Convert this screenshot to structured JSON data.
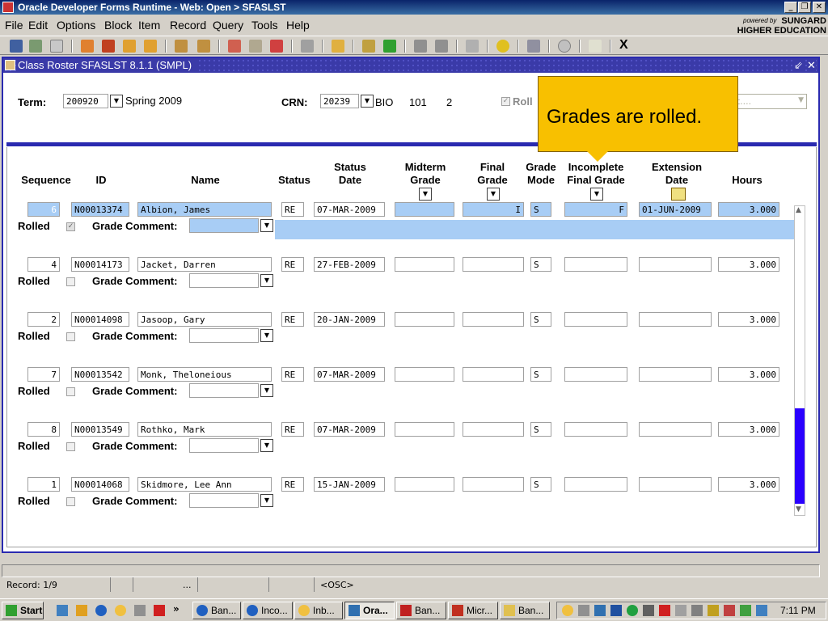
{
  "window": {
    "title": "Oracle Developer Forms Runtime - Web:  Open > SFASLST"
  },
  "brand": {
    "powered_by": "powered by",
    "line1": "SUNGARD",
    "line2": "HIGHER EDUCATION"
  },
  "menu": [
    {
      "label": "File",
      "accel": "F"
    },
    {
      "label": "Edit",
      "accel": "E"
    },
    {
      "label": "Options",
      "accel": "O"
    },
    {
      "label": "Block",
      "accel": "B"
    },
    {
      "label": "Item",
      "accel": "I"
    },
    {
      "label": "Record",
      "accel": "R"
    },
    {
      "label": "Query",
      "accel": "Q"
    },
    {
      "label": "Tools",
      "accel": "T"
    },
    {
      "label": "Help",
      "accel": "H"
    }
  ],
  "toolbar": {
    "exit_label": "X"
  },
  "form": {
    "title": "Class Roster  SFASLST  8.1.1  (SMPL)",
    "term_label": "Term:",
    "term_value": "200920",
    "term_desc": "Spring 2009",
    "crn_label": "CRN:",
    "crn_value": "20239",
    "subject": "BIO",
    "course": "101",
    "section": "2",
    "roll_label": "Roll",
    "select_placeholder": "ect...."
  },
  "columns": {
    "sequence": "Sequence",
    "id": "ID",
    "name": "Name",
    "status": "Status",
    "status_date": [
      "Status",
      "Date"
    ],
    "midterm": [
      "Midterm",
      "Grade"
    ],
    "final": [
      "Final",
      "Grade"
    ],
    "grade_mode": [
      "Grade",
      "Mode"
    ],
    "incomplete": [
      "Incomplete",
      "Final Grade"
    ],
    "extension": [
      "Extension",
      "Date"
    ],
    "hours": "Hours"
  },
  "row_labels": {
    "rolled": "Rolled",
    "grade_comment": "Grade Comment:"
  },
  "rows": [
    {
      "seq": "6",
      "id": "N00013374",
      "name": "Albion, James",
      "status": "RE",
      "date": "07-MAR-2009",
      "midterm": "",
      "final": "I",
      "mode": "S",
      "incomplete": "F",
      "extension": "01-JUN-2009",
      "hours": "3.000",
      "rolled": true,
      "selected": true
    },
    {
      "seq": "4",
      "id": "N00014173",
      "name": "Jacket, Darren",
      "status": "RE",
      "date": "27-FEB-2009",
      "midterm": "",
      "final": "",
      "mode": "S",
      "incomplete": "",
      "extension": "",
      "hours": "3.000",
      "rolled": false,
      "selected": false
    },
    {
      "seq": "2",
      "id": "N00014098",
      "name": "Jasoop, Gary",
      "status": "RE",
      "date": "20-JAN-2009",
      "midterm": "",
      "final": "",
      "mode": "S",
      "incomplete": "",
      "extension": "",
      "hours": "3.000",
      "rolled": false,
      "selected": false
    },
    {
      "seq": "7",
      "id": "N00013542",
      "name": "Monk, Theloneious",
      "status": "RE",
      "date": "07-MAR-2009",
      "midterm": "",
      "final": "",
      "mode": "S",
      "incomplete": "",
      "extension": "",
      "hours": "3.000",
      "rolled": false,
      "selected": false
    },
    {
      "seq": "8",
      "id": "N00013549",
      "name": "Rothko, Mark",
      "status": "RE",
      "date": "07-MAR-2009",
      "midterm": "",
      "final": "",
      "mode": "S",
      "incomplete": "",
      "extension": "",
      "hours": "3.000",
      "rolled": false,
      "selected": false
    },
    {
      "seq": "1",
      "id": "N00014068",
      "name": "Skidmore, Lee Ann",
      "status": "RE",
      "date": "15-JAN-2009",
      "midterm": "",
      "final": "",
      "mode": "S",
      "incomplete": "",
      "extension": "",
      "hours": "3.000",
      "rolled": false,
      "selected": false
    }
  ],
  "callout": {
    "text": "Grades are rolled."
  },
  "status": {
    "record": "Record: 1/9",
    "dots": "...",
    "osc": "<OSC>"
  },
  "taskbar": {
    "start": "Start",
    "more": "»",
    "buttons": [
      "Ban...",
      "Inco...",
      "Inb...",
      "Ora...",
      "Ban...",
      "Micr...",
      "Ban..."
    ],
    "clock": "7:11 PM"
  },
  "colors": {
    "accent": "#2a2ab0",
    "callout": "#f8c000",
    "selection": "#a8cdf5",
    "scrollthumb": "#2a00ff"
  }
}
